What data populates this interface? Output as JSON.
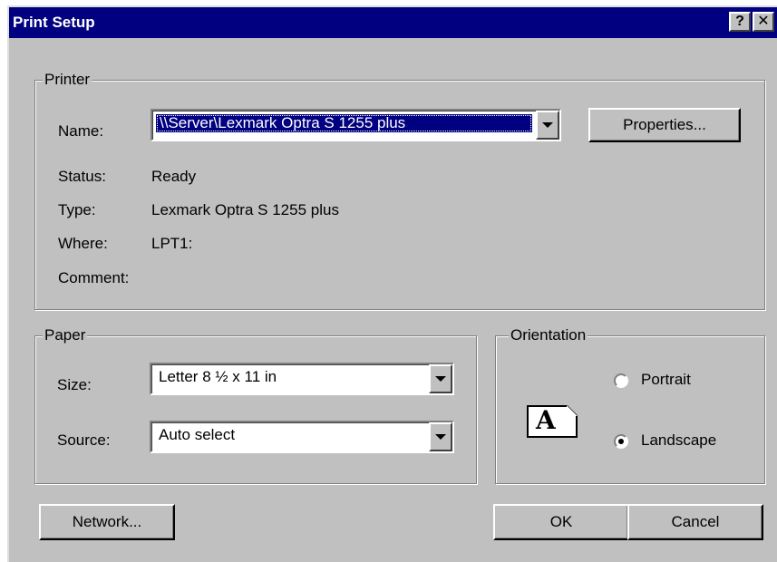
{
  "window": {
    "title": "Print Setup",
    "help_button": "?",
    "close_button": "✕"
  },
  "printer": {
    "legend": "Printer",
    "name_label": "Name:",
    "name_value": "\\\\Server\\Lexmark Optra S 1255 plus",
    "properties_button": "Properties...",
    "status_label": "Status:",
    "status_value": "Ready",
    "type_label": "Type:",
    "type_value": "Lexmark Optra S 1255 plus",
    "where_label": "Where:",
    "where_value": "LPT1:",
    "comment_label": "Comment:",
    "comment_value": ""
  },
  "paper": {
    "legend": "Paper",
    "size_label": "Size:",
    "size_value": "Letter 8 ½ x 11 in",
    "source_label": "Source:",
    "source_value": "Auto select"
  },
  "orientation": {
    "legend": "Orientation",
    "icon_letter": "A",
    "portrait_label": "Portrait",
    "landscape_label": "Landscape",
    "selected": "Landscape"
  },
  "buttons": {
    "network": "Network...",
    "ok": "OK",
    "cancel": "Cancel"
  }
}
